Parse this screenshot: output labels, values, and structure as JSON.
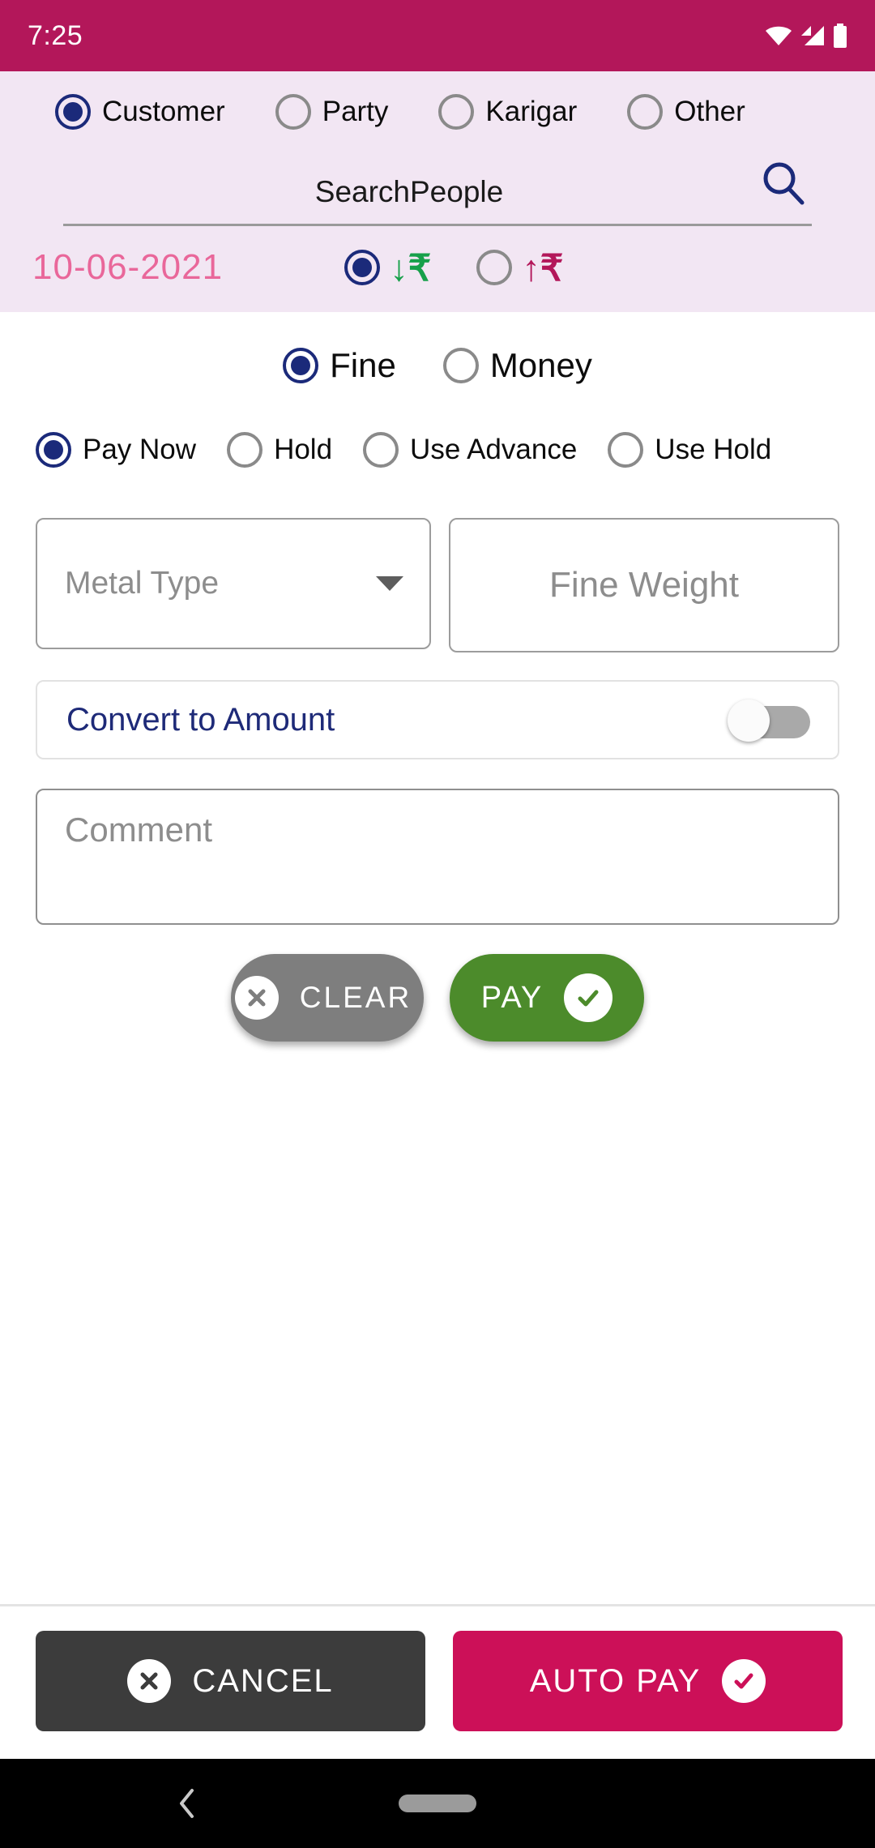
{
  "status_bar": {
    "time": "7:25",
    "icons": [
      "wifi-icon",
      "signal-icon",
      "battery-icon"
    ],
    "background_color": "#b3175a"
  },
  "header": {
    "background_color": "#f2e6f3",
    "person_type": {
      "selected": "Customer",
      "options": [
        {
          "label": "Customer",
          "selected": true
        },
        {
          "label": "Party",
          "selected": false
        },
        {
          "label": "Karigar",
          "selected": false
        },
        {
          "label": "Other",
          "selected": false
        }
      ]
    },
    "search": {
      "value": "",
      "placeholder": "SearchPeople",
      "icon": "search-icon"
    },
    "date": "10-06-2021",
    "direction": {
      "selected": "in",
      "options": [
        {
          "id": "in",
          "icon": "arrow-down-rupee-icon",
          "glyph": "↓₹",
          "color": "#17a04a",
          "selected": true
        },
        {
          "id": "out",
          "icon": "arrow-up-rupee-icon",
          "glyph": "↑₹",
          "color": "#b3175a",
          "selected": false
        }
      ]
    }
  },
  "form": {
    "entry_type": {
      "selected": "Fine",
      "options": [
        {
          "label": "Fine",
          "selected": true
        },
        {
          "label": "Money",
          "selected": false
        }
      ]
    },
    "payment_mode": {
      "selected": "Pay Now",
      "options": [
        {
          "label": "Pay Now",
          "selected": true
        },
        {
          "label": "Hold",
          "selected": false
        },
        {
          "label": "Use Advance",
          "selected": false
        },
        {
          "label": "Use Hold",
          "selected": false
        }
      ]
    },
    "metal_type": {
      "value": "",
      "placeholder": "Metal Type",
      "icon": "chevron-down-icon"
    },
    "fine_weight": {
      "value": "",
      "placeholder": "Fine Weight"
    },
    "convert_to_amount": {
      "label": "Convert to Amount",
      "enabled": false,
      "accent_color": "#1e2a78"
    },
    "comment": {
      "value": "",
      "placeholder": "Comment"
    },
    "actions": {
      "clear": {
        "label": "CLEAR",
        "icon": "close-circle-icon",
        "color": "#7e7e7e"
      },
      "pay": {
        "label": "PAY",
        "icon": "check-circle-icon",
        "color": "#4c8b2b"
      }
    }
  },
  "bottom_bar": {
    "cancel": {
      "label": "CANCEL",
      "icon": "close-circle-icon",
      "color": "#3c3c3c"
    },
    "auto_pay": {
      "label": "AUTO PAY",
      "icon": "check-circle-icon",
      "color": "#cc1058"
    }
  },
  "nav_bar": {
    "back": "back-icon",
    "home": "home-indicator"
  }
}
